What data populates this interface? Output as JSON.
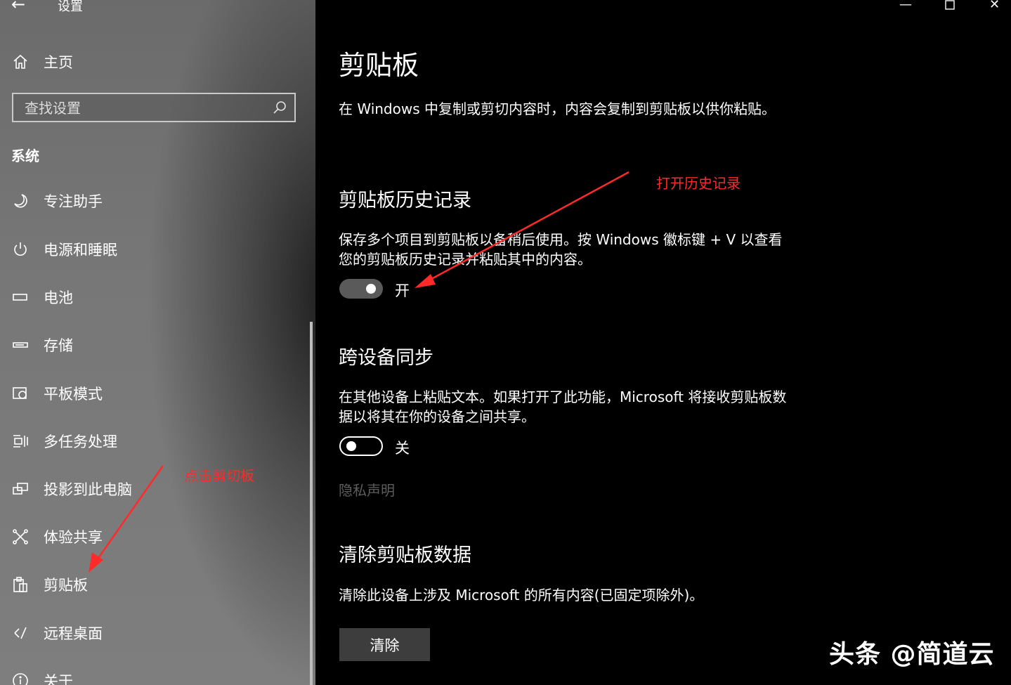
{
  "window": {
    "title": "设置"
  },
  "sidebar": {
    "home_label": "主页",
    "search_placeholder": "查找设置",
    "section_title": "系统",
    "items": [
      {
        "label": "专注助手",
        "icon": "moon-icon"
      },
      {
        "label": "电源和睡眠",
        "icon": "power-icon"
      },
      {
        "label": "电池",
        "icon": "battery-icon"
      },
      {
        "label": "存储",
        "icon": "storage-icon"
      },
      {
        "label": "平板模式",
        "icon": "tablet-mode-icon"
      },
      {
        "label": "多任务处理",
        "icon": "multitasking-icon"
      },
      {
        "label": "投影到此电脑",
        "icon": "project-icon"
      },
      {
        "label": "体验共享",
        "icon": "shared-experience-icon"
      },
      {
        "label": "剪贴板",
        "icon": "clipboard-icon"
      },
      {
        "label": "远程桌面",
        "icon": "remote-desktop-icon"
      },
      {
        "label": "关于",
        "icon": "info-icon"
      }
    ]
  },
  "main": {
    "title": "剪贴板",
    "intro": "在 Windows 中复制或剪切内容时，内容会复制到剪贴板以供你粘贴。",
    "history": {
      "heading": "剪贴板历史记录",
      "description": "保存多个项目到剪贴板以备稍后使用。按 Windows 徽标键 + V 以查看您的剪贴板历史记录并粘贴其中的内容。",
      "state_label": "开",
      "on": true
    },
    "sync": {
      "heading": "跨设备同步",
      "description": "在其他设备上粘贴文本。如果打开了此功能，Microsoft 将接收剪贴板数据以将其在你的设备之间共享。",
      "state_label": "关",
      "on": false
    },
    "privacy_link": "隐私声明",
    "clear": {
      "heading": "清除剪贴板数据",
      "description": "清除此设备上涉及 Microsoft 的所有内容(已固定项除外)。",
      "button_label": "清除"
    }
  },
  "annotations": {
    "click_clipboard": "点击剪切板",
    "open_history": "打开历史记录",
    "color": "#ff2a2a"
  },
  "watermark": "头条 @简道云"
}
